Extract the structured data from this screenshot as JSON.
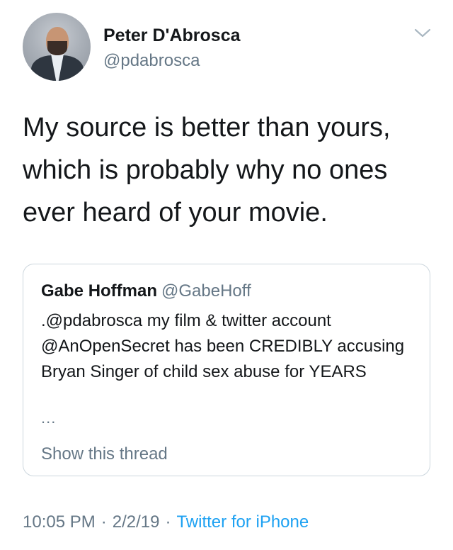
{
  "author": {
    "name": "Peter D'Abrosca",
    "handle": "@pdabrosca"
  },
  "tweet": {
    "text": "My source is better than yours, which is probably why no ones ever heard of your movie."
  },
  "quoted_tweet": {
    "name": "Gabe Hoffman",
    "handle": "@GabeHoff",
    "text": ".@pdabrosca my film & twitter account @AnOpenSecret has been CREDIBLY accusing Bryan Singer of child sex abuse for YEARS",
    "ellipsis": "...",
    "show_thread_label": "Show this thread"
  },
  "meta": {
    "time": "10:05 PM",
    "separator": "·",
    "date": "2/2/19",
    "source": "Twitter for iPhone"
  },
  "icons": {
    "avatar": "profile-photo",
    "menu": "chevron-down-icon"
  },
  "colors": {
    "text": "#14171a",
    "secondary": "#657786",
    "link": "#1da1f2",
    "border": "#ccd6dd"
  }
}
